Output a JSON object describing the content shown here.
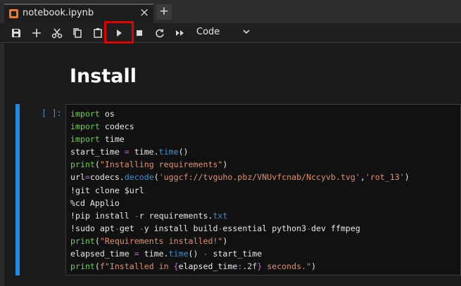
{
  "tab": {
    "title": "notebook.ipynb",
    "close": "×",
    "new": "+"
  },
  "toolbar": {
    "cell_type": "Code",
    "icons": [
      "save-icon",
      "add-icon",
      "cut-icon",
      "copy-icon",
      "paste-icon",
      "run-icon",
      "stop-icon",
      "restart-icon",
      "fast-forward-icon"
    ]
  },
  "notebook": {
    "heading": "Install",
    "prompt": "[ ]:",
    "code_lines": [
      "import os",
      "import codecs",
      "import time",
      "start_time = time.time()",
      "print(\"Installing requirements\")",
      "url=codecs.decode('uggcf://tvguho.pbz/VNUvfcnab/Nccyvb.tvg','rot_13')",
      "!git clone $url",
      "%cd Applio",
      "!pip install -r requirements.txt",
      "!sudo apt-get -y install build-essential python3-dev ffmpeg",
      "print(\"Requirements installed!\")",
      "elapsed_time = time.time() - start_time",
      "print(f\"Installed in {elapsed_time:.2f} seconds.\")"
    ]
  },
  "colors": {
    "accent": "#1e88e5",
    "highlight": "#e00000",
    "keyword": "#6fcf50",
    "string": "#e0906e"
  }
}
